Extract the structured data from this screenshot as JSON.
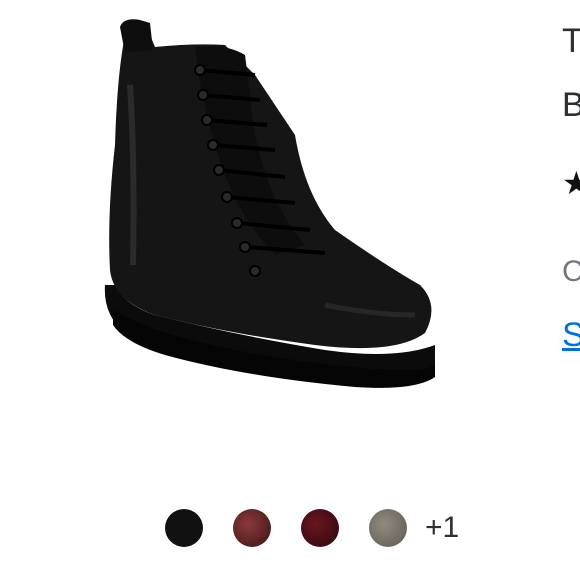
{
  "product": {
    "title_fragment": "T",
    "brand_fragment": "B",
    "rating_icon": "star-icon",
    "option_fragment": "C",
    "link_fragment": "S"
  },
  "swatches": {
    "colors": [
      "#111111",
      "#6b2a2a",
      "#4a0f17",
      "#7c7468"
    ],
    "more_label": "+1"
  }
}
